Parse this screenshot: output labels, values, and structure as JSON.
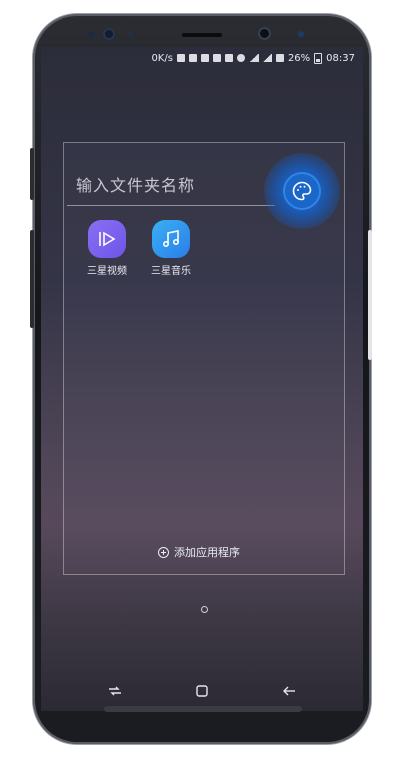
{
  "status_bar": {
    "network_speed": "0K/s",
    "battery_percent": "26%",
    "time": "08:37"
  },
  "folder": {
    "name_placeholder": "输入文件夹名称",
    "add_apps_label": "添加应用程序",
    "apps": [
      {
        "label": "三星视频",
        "icon": "video-play-icon",
        "color": "#7a62ee"
      },
      {
        "label": "三星音乐",
        "icon": "music-note-icon",
        "color": "#2f8ff0"
      }
    ]
  },
  "palette_button": {
    "icon": "palette-icon",
    "color": "#1a66c9"
  },
  "page_indicator": {
    "current": 1,
    "total": 1
  },
  "nav": {
    "recents": "recents-icon",
    "home": "home-icon",
    "back": "back-icon"
  }
}
